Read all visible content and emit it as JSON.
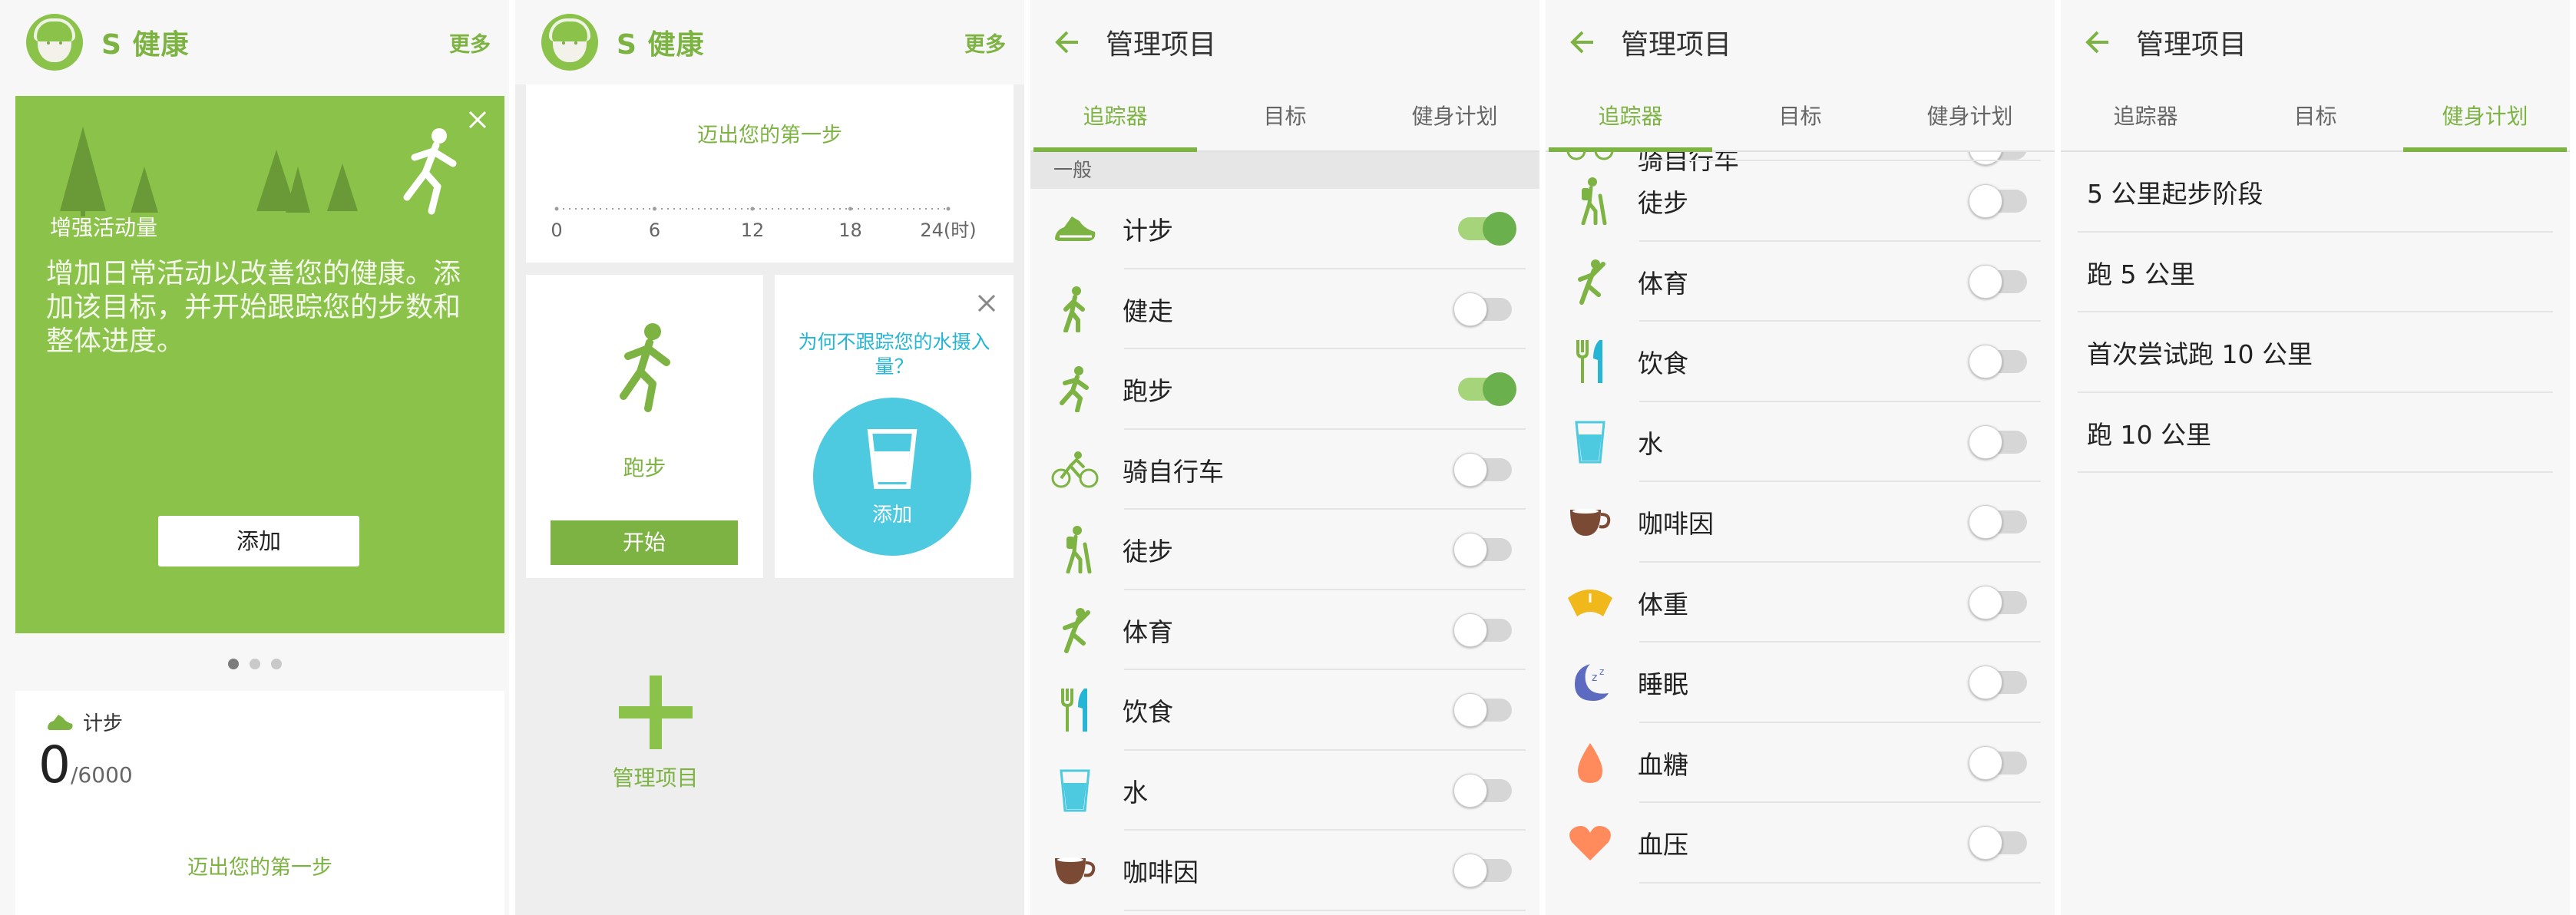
{
  "screen1": {
    "app_title": "S 健康",
    "more": "更多",
    "hero": {
      "tagline": "增强活动量",
      "body": "增加日常活动以改善您的健康。添加该目标，并开始跟踪您的步数和整体进度。",
      "add_button": "添加"
    },
    "steps": {
      "label": "计步",
      "count": "0",
      "goal": "/6000",
      "first_step": "迈出您的第一步"
    }
  },
  "screen2": {
    "app_title": "S 健康",
    "more": "更多",
    "chart": {
      "title": "迈出您的第一步",
      "ticks": [
        "0",
        "6",
        "12",
        "18",
        "24(时)"
      ]
    },
    "chart_data": {
      "type": "line",
      "title": "迈出您的第一步",
      "x": [
        0,
        6,
        12,
        18,
        24
      ],
      "xticks": [
        "0",
        "6",
        "12",
        "18",
        "24(时)"
      ],
      "series": [],
      "xlabel": "",
      "ylabel": ""
    },
    "run_card": {
      "label": "跑步",
      "start_button": "开始"
    },
    "water_card": {
      "question": "为何不跟踪您的水摄入量？",
      "add": "添加"
    },
    "manage": {
      "label": "管理项目"
    }
  },
  "screen3": {
    "title": "管理项目",
    "tabs": [
      "追踪器",
      "目标",
      "健身计划"
    ],
    "section": "一般",
    "rows": [
      {
        "label": "计步",
        "icon": "shoe-icon",
        "on": true
      },
      {
        "label": "健走",
        "icon": "walking-icon",
        "on": false
      },
      {
        "label": "跑步",
        "icon": "running-icon",
        "on": true
      },
      {
        "label": "骑自行车",
        "icon": "cycling-icon",
        "on": false
      },
      {
        "label": "徒步",
        "icon": "hiking-icon",
        "on": false
      },
      {
        "label": "体育",
        "icon": "sports-icon",
        "on": false
      },
      {
        "label": "饮食",
        "icon": "food-icon",
        "on": false
      },
      {
        "label": "水",
        "icon": "water-icon",
        "on": false
      },
      {
        "label": "咖啡因",
        "icon": "coffee-icon",
        "on": false
      }
    ]
  },
  "screen4": {
    "title": "管理项目",
    "tabs": [
      "追踪器",
      "目标",
      "健身计划"
    ],
    "partial_row": "骑自行车",
    "rows": [
      {
        "label": "徒步",
        "icon": "hiking-icon",
        "on": false
      },
      {
        "label": "体育",
        "icon": "sports-icon",
        "on": false
      },
      {
        "label": "饮食",
        "icon": "food-icon",
        "on": false
      },
      {
        "label": "水",
        "icon": "water-icon",
        "on": false
      },
      {
        "label": "咖啡因",
        "icon": "coffee-icon",
        "on": false
      },
      {
        "label": "体重",
        "icon": "weight-icon",
        "on": false
      },
      {
        "label": "睡眠",
        "icon": "sleep-icon",
        "on": false
      },
      {
        "label": "血糖",
        "icon": "blood-glucose-icon",
        "on": false
      },
      {
        "label": "血压",
        "icon": "blood-pressure-icon",
        "on": false
      }
    ]
  },
  "screen5": {
    "title": "管理项目",
    "tabs": [
      "追踪器",
      "目标",
      "健身计划"
    ],
    "plans": [
      "5 公里起步阶段",
      "跑 5 公里",
      "首次尝试跑 10 公里",
      "跑 10 公里"
    ]
  },
  "colors": {
    "accent": "#7cb342",
    "hero_bg": "#8bc34a",
    "water": "#4dc9e0",
    "toggle_on": "#6ab04c"
  }
}
